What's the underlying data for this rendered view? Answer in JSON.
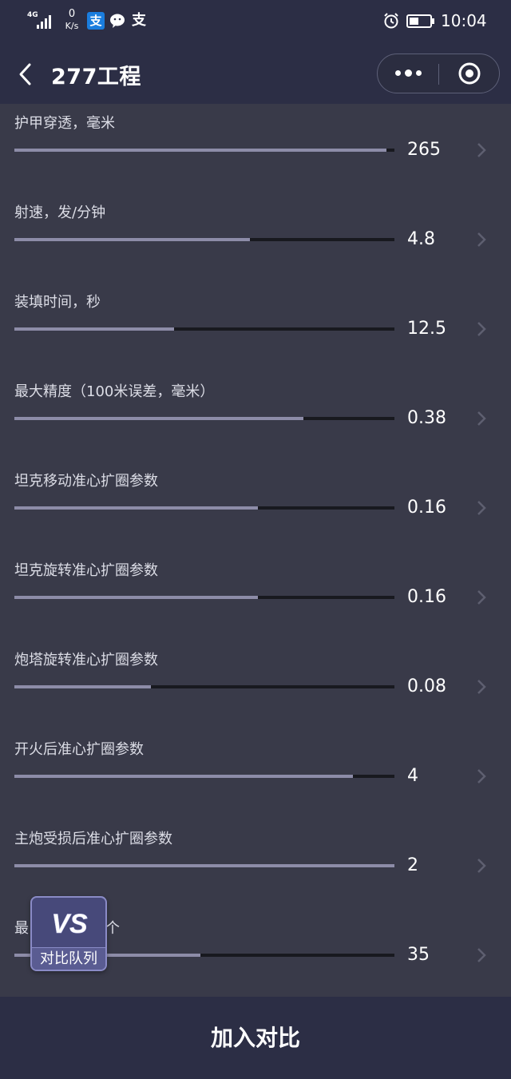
{
  "status_bar": {
    "network_type": "4G",
    "speed_value": "0",
    "speed_unit": "K/s",
    "alipay_glyph": "支",
    "alipay2_glyph": "支",
    "time": "10:04",
    "icons": [
      "signal-icon",
      "alipay-icon",
      "wechat-icon",
      "alipay-icon",
      "alarm-icon",
      "battery-icon"
    ]
  },
  "nav": {
    "title": "277工程",
    "icons": [
      "back-icon",
      "more-icon",
      "close-target-icon"
    ]
  },
  "stats": [
    {
      "label": "护甲穿透，毫米",
      "value": "265",
      "fill": 0.98
    },
    {
      "label": "射速，发/分钟",
      "value": "4.8",
      "fill": 0.62
    },
    {
      "label": "装填时间，秒",
      "value": "12.5",
      "fill": 0.42
    },
    {
      "label": "最大精度（100米误差，毫米）",
      "value": "0.38",
      "fill": 0.76
    },
    {
      "label": "坦克移动准心扩圈参数",
      "value": "0.16",
      "fill": 0.64
    },
    {
      "label": "坦克旋转准心扩圈参数",
      "value": "0.16",
      "fill": 0.64
    },
    {
      "label": "炮塔旋转准心扩圈参数",
      "value": "0.08",
      "fill": 0.36
    },
    {
      "label": "开火后准心扩圈参数",
      "value": "4",
      "fill": 0.89
    },
    {
      "label": "主炮受损后准心扩圈参数",
      "value": "2",
      "fill": 1.0
    },
    {
      "label_visible_start": "最",
      "label_visible_end": "个",
      "value": "35",
      "fill": 0.49
    }
  ],
  "vs_button": {
    "logo_text": "VS",
    "label": "对比队列"
  },
  "bottom": {
    "add_compare_label": "加入对比"
  },
  "colors": {
    "background": "#393a49",
    "bar_background": "#2c2e45",
    "track": "#18191f",
    "fill": "#8d8ca8",
    "vs_button": "#47497a"
  }
}
